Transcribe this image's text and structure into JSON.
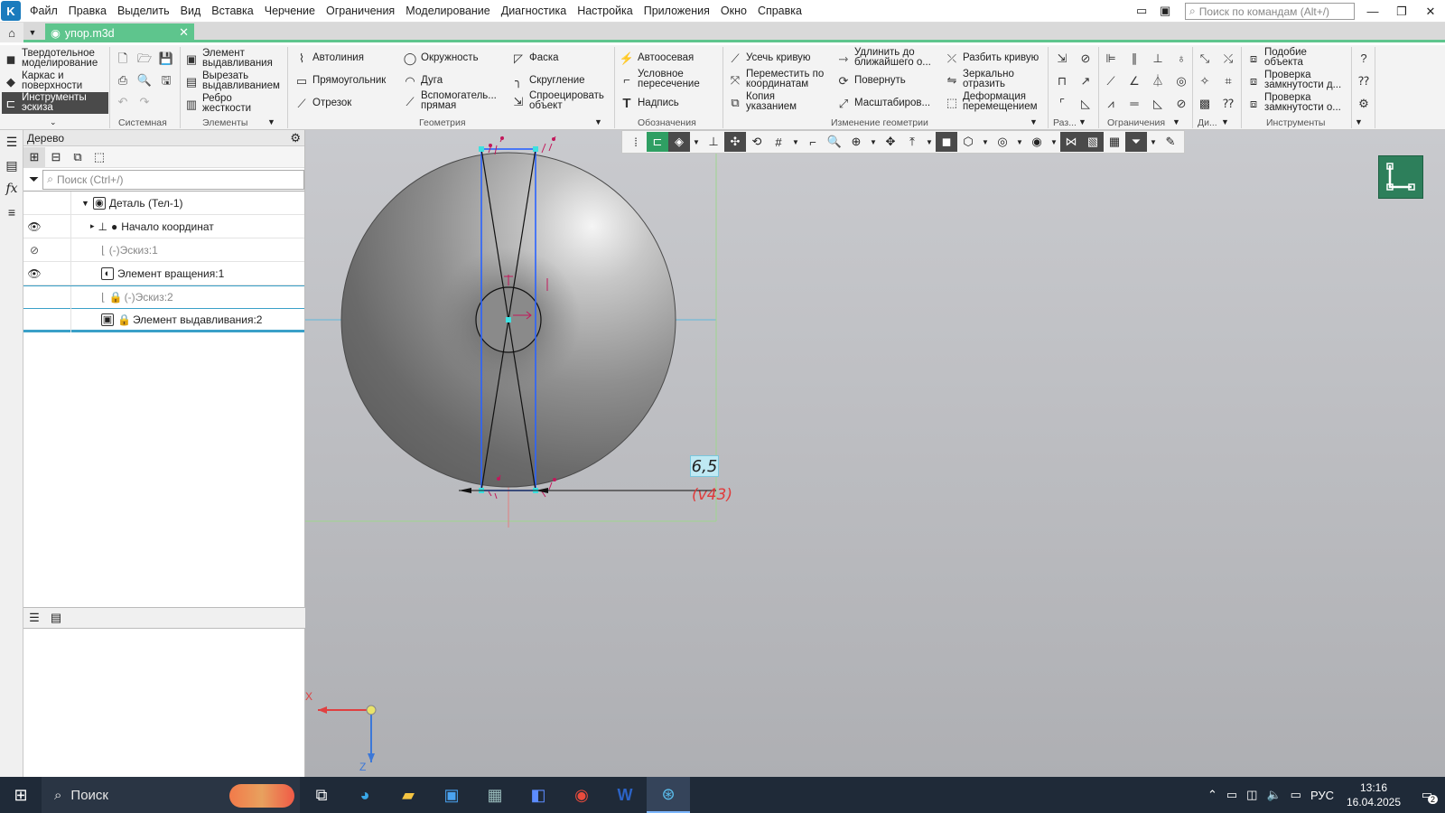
{
  "menubar": {
    "items": [
      "Файл",
      "Правка",
      "Выделить",
      "Вид",
      "Вставка",
      "Черчение",
      "Ограничения",
      "Моделирование",
      "Диагностика",
      "Настройка",
      "Приложения",
      "Окно",
      "Справка"
    ],
    "search_placeholder": "Поиск по командам (Alt+/)"
  },
  "tabbar": {
    "doc_tab": "упор.m3d"
  },
  "ribbon": {
    "modes": [
      "Твердотельное моделирование",
      "Каркас и поверхности",
      "Инструменты эскиза"
    ],
    "elements": [
      "Элемент выдавливания",
      "Вырезать выдавливанием",
      "Ребро жесткости"
    ],
    "geometry": [
      "Автолиния",
      "Прямоугольник",
      "Отрезок",
      "Окружность",
      "Дуга",
      "Вспомогатель... прямая",
      "Фаска",
      "Скругление",
      "Спроецировать объект"
    ],
    "designations": [
      "Автоосевая",
      "Условное пересечение",
      "Надпись"
    ],
    "change_geometry": [
      "Усечь кривую",
      "Переместить по координатам",
      "Копия указанием",
      "Удлинить до ближайшего о...",
      "Повернуть",
      "Масштабиров...",
      "Разбить кривую",
      "Зеркально отразить",
      "Деформация перемещением"
    ],
    "instruments": [
      "Подобие объекта",
      "Проверка замкнутости д...",
      "Проверка замкнутости о..."
    ],
    "group_labels": [
      "Системная",
      "Элементы",
      "Геометрия",
      "Обозначения",
      "Изменение геометрии",
      "Раз...",
      "Ограничения",
      "Ди...",
      "Инструменты"
    ]
  },
  "tree": {
    "title": "Дерево",
    "search_placeholder": "Поиск (Ctrl+/)",
    "rows": [
      {
        "label": "Деталь (Тел-1)"
      },
      {
        "label": "Начало координат"
      },
      {
        "label": "(-)Эскиз:1"
      },
      {
        "label": "Элемент вращения:1"
      },
      {
        "label": "(-)Эскиз:2"
      },
      {
        "label": "Элемент выдавливания:2"
      }
    ]
  },
  "viewport": {
    "dimension_value": "6,5",
    "dimension_var": "(v43)",
    "axis_x": "X",
    "axis_z": "Z"
  },
  "taskbar": {
    "search_label": "Поиск",
    "lang": "РУС",
    "time": "13:16",
    "date": "16.04.2025",
    "notifications": "2"
  }
}
